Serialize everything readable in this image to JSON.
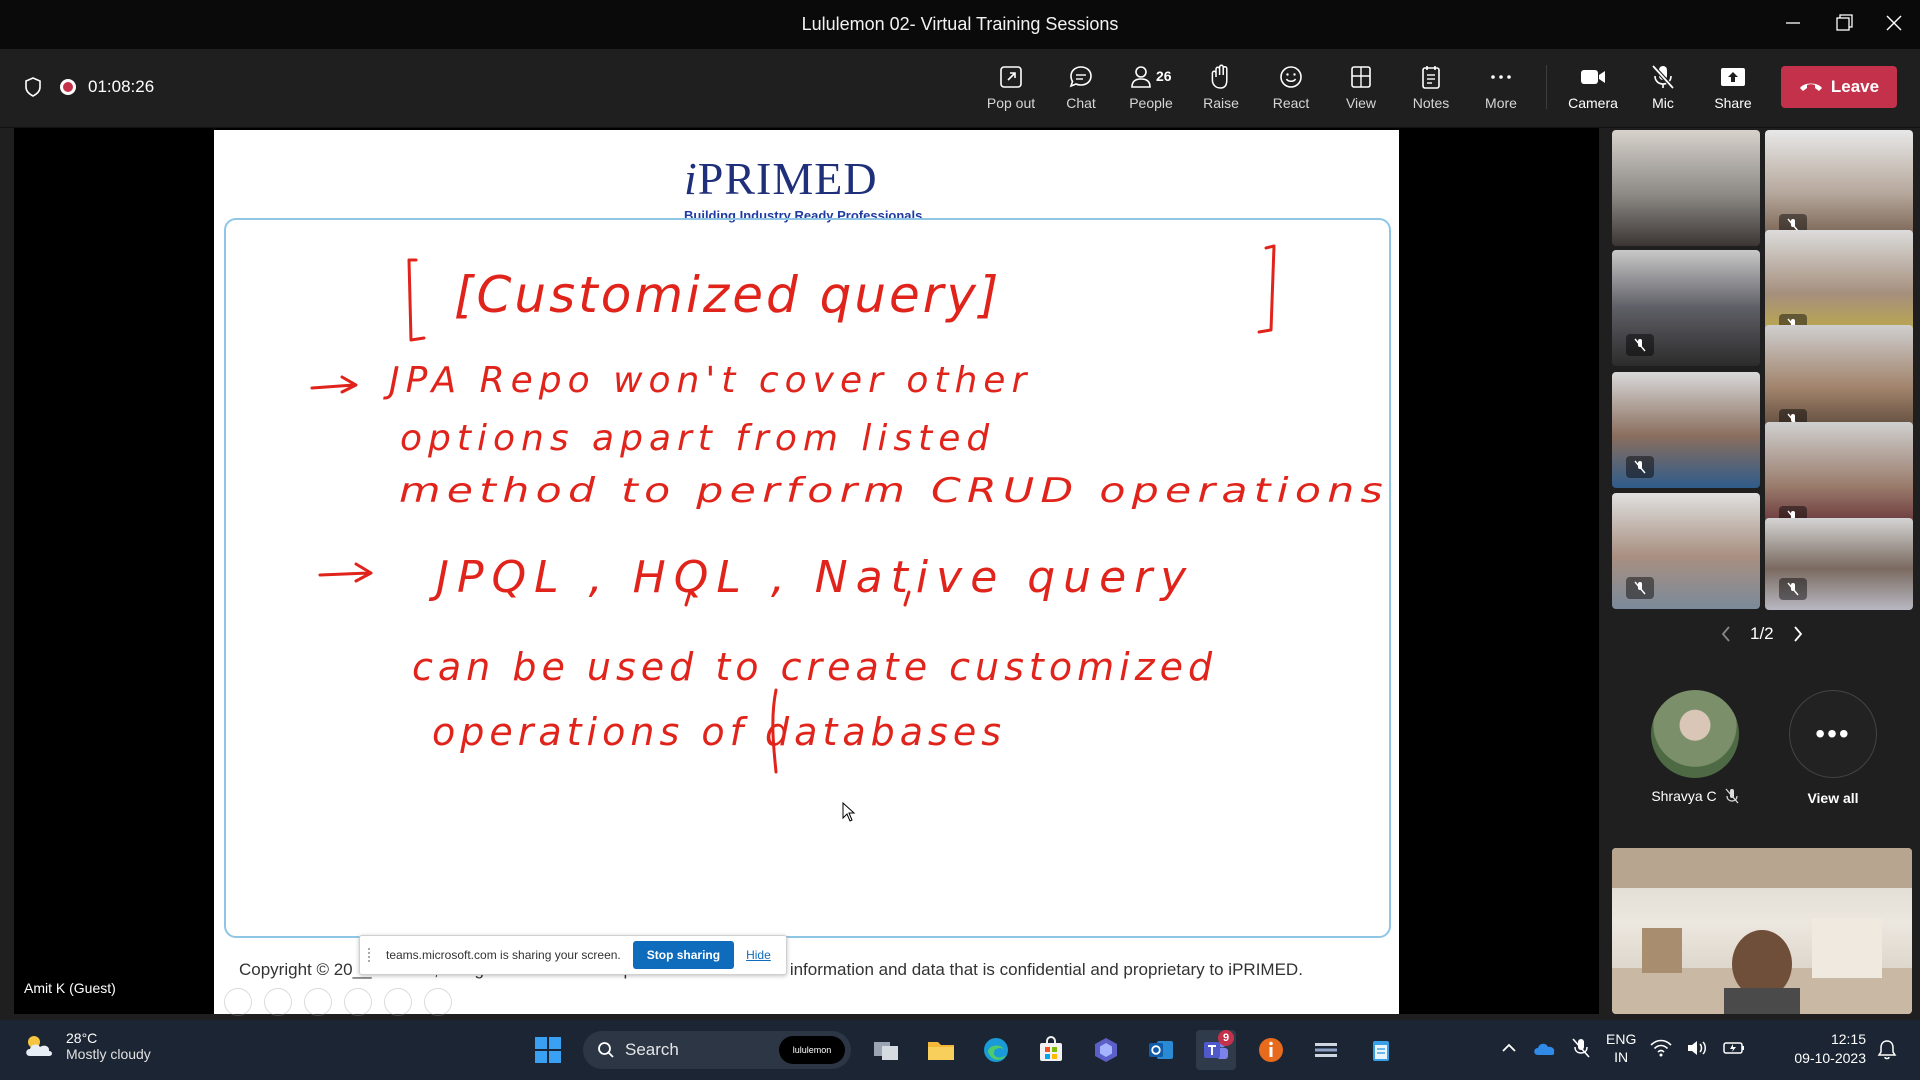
{
  "window": {
    "title": "Lululemon 02- Virtual Training Sessions"
  },
  "toolbar": {
    "timer": "01:08:26",
    "buttons": {
      "pop_out": "Pop out",
      "chat": "Chat",
      "people": "People",
      "people_count": "26",
      "raise": "Raise",
      "react": "React",
      "view": "View",
      "notes": "Notes",
      "more": "More",
      "camera": "Camera",
      "mic": "Mic",
      "share": "Share",
      "leave": "Leave"
    }
  },
  "slide": {
    "logo_text_i": "i",
    "logo_text_rest": "PRIMED",
    "tagline": "Building Industry Ready Professionals",
    "handwriting": {
      "heading": "[Customized query]",
      "line1": "JPA Repo won't cover other",
      "line2": "options apart from listed",
      "line3": "method to perform CRUD operations",
      "line4": "JPQL , HQL , Native query",
      "line5": "can be used to create customized",
      "line6": "operations of databases"
    },
    "copyright": "Copyright © 20__ iPrimed, all rights reserved. This presentation contains information and data that is confidential and proprietary to iPRIMED."
  },
  "share_bar": {
    "message": "teams.microsoft.com is sharing your screen.",
    "stop_label": "Stop sharing",
    "hide_label": "Hide"
  },
  "stage": {
    "presenter_name": "Amit K (Guest)"
  },
  "gallery": {
    "pager": "1/2",
    "featured_participant": "Shravya C",
    "view_all_label": "View all"
  },
  "taskbar": {
    "weather_temp": "28°C",
    "weather_desc": "Mostly cloudy",
    "search_label": "Search",
    "search_pill": "lululemon",
    "teams_badge": "9",
    "lang_line1": "ENG",
    "lang_line2": "IN",
    "time": "12:15",
    "date": "09-10-2023"
  },
  "colors": {
    "leave_red": "#c4314b",
    "share_blue": "#0f6cbd",
    "ink_red": "#e0241b",
    "slide_frame": "#8fc6e6",
    "logo_navy": "#1f2f7a"
  }
}
